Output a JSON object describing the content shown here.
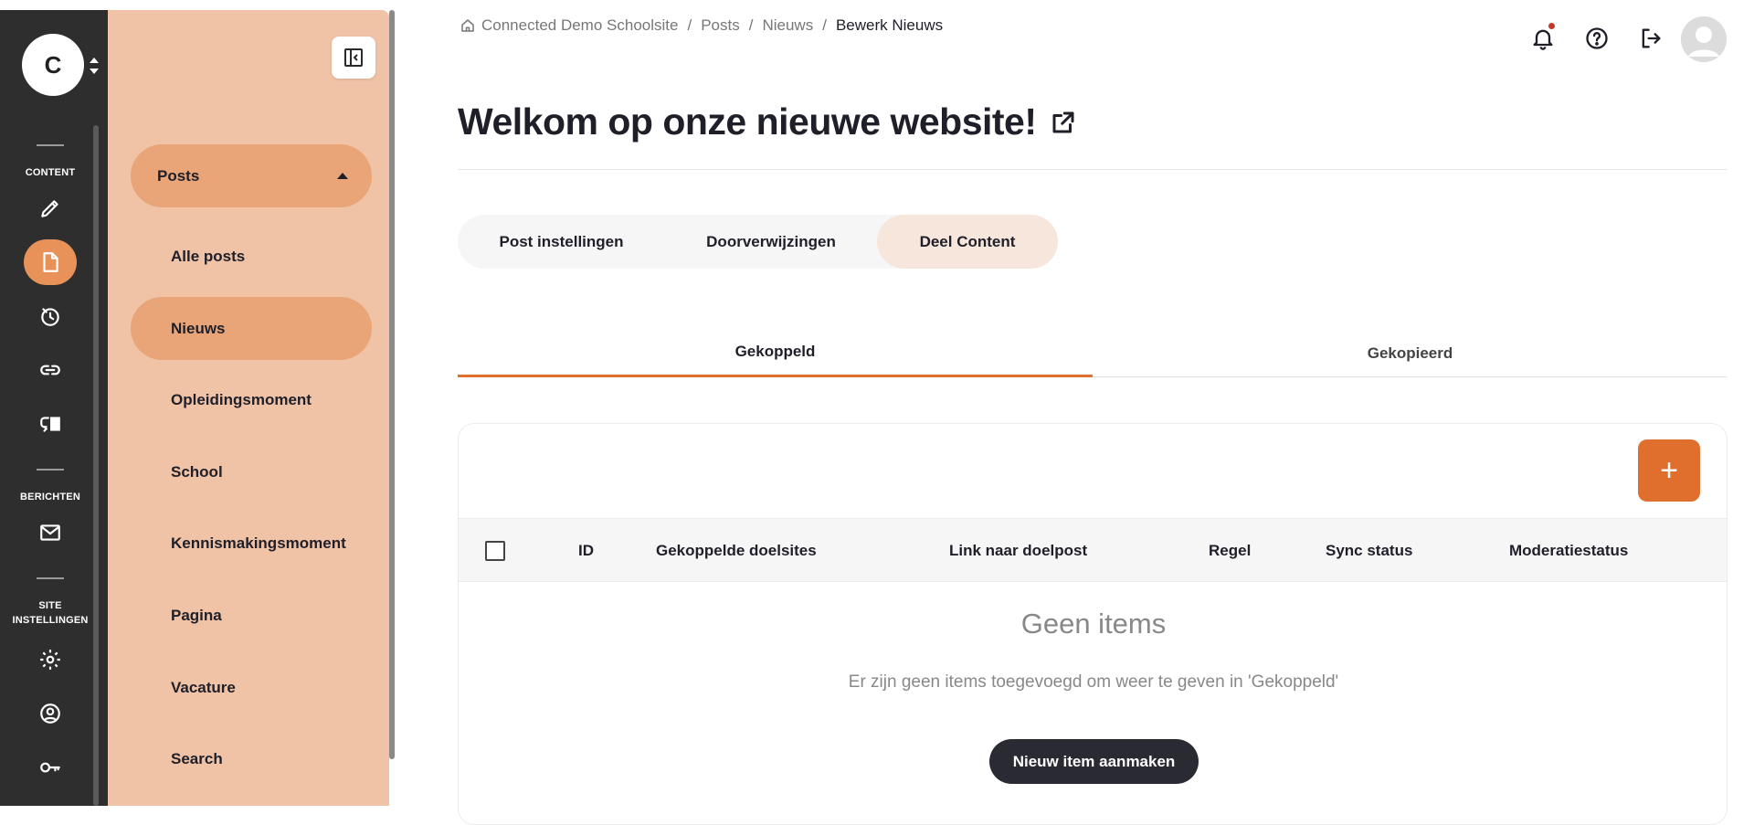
{
  "org": {
    "initial": "C"
  },
  "rail": {
    "sections": [
      {
        "label": "CONTENT"
      },
      {
        "label": "BERICHTEN"
      },
      {
        "label_line1": "SITE",
        "label_line2": "INSTELLINGEN"
      }
    ],
    "icons": [
      "pencil-icon",
      "document-icon",
      "history-icon",
      "link-icon",
      "sync-icon",
      "mail-icon",
      "gear-icon",
      "user-circle-icon",
      "key-icon"
    ],
    "active_icon": "document-icon",
    "accent": "#e8925a"
  },
  "subnav": {
    "group_label": "Posts",
    "items": [
      {
        "label": "Alle posts"
      },
      {
        "label": "Nieuws"
      },
      {
        "label": "Opleidingsmoment"
      },
      {
        "label": "School"
      },
      {
        "label": "Kennismakingsmoment"
      },
      {
        "label": "Pagina"
      },
      {
        "label": "Vacature"
      },
      {
        "label": "Search"
      }
    ],
    "active_item": "Nieuws",
    "background": "#f0c3a7"
  },
  "breadcrumb": {
    "items": [
      "Connected Demo Schoolsite",
      "Posts",
      "Nieuws"
    ],
    "current": "Bewerk Nieuws",
    "separator": "/"
  },
  "page": {
    "title": "Welkom op onze nieuwe website!"
  },
  "pill_tabs": {
    "items": [
      {
        "label": "Post instellingen"
      },
      {
        "label": "Doorverwijzingen"
      },
      {
        "label": "Deel Content"
      }
    ],
    "active": "Deel Content"
  },
  "underline_tabs": {
    "items": [
      {
        "label": "Gekoppeld"
      },
      {
        "label": "Gekopieerd"
      }
    ],
    "active": "Gekoppeld",
    "accent": "#e06e2c"
  },
  "table": {
    "add_label": "+",
    "columns": [
      "ID",
      "Gekoppelde doelsites",
      "Link naar doelpost",
      "Regel",
      "Sync status",
      "Moderatiestatus"
    ],
    "empty_title": "Geen items",
    "empty_description": "Er zijn geen items toegevoegd om weer te geven in 'Gekoppeld'",
    "new_item_label": "Nieuw item aanmaken"
  }
}
